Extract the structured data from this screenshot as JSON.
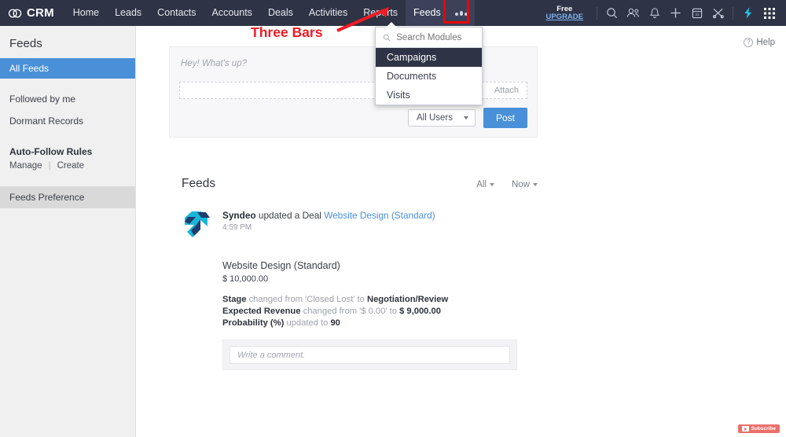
{
  "topbar": {
    "brand": "CRM",
    "nav": [
      {
        "label": "Home",
        "active": false
      },
      {
        "label": "Leads",
        "active": false
      },
      {
        "label": "Contacts",
        "active": false
      },
      {
        "label": "Accounts",
        "active": false
      },
      {
        "label": "Deals",
        "active": false
      },
      {
        "label": "Activities",
        "active": false
      },
      {
        "label": "Reports",
        "active": false
      },
      {
        "label": "Feeds",
        "active": true
      }
    ],
    "more_icon": "three-bars-icon",
    "upgrade": {
      "free": "Free",
      "link": "UPGRADE"
    },
    "icons": [
      "search-icon",
      "users-icon",
      "bell-icon",
      "plus-icon",
      "calendar-icon",
      "tools-icon",
      "lightning-logo-icon",
      "app-grid-icon"
    ],
    "accent": "#4a90d9",
    "background": "#2e3346"
  },
  "modules_dropdown": {
    "search_placeholder": "Search Modules",
    "items": [
      {
        "label": "Campaigns",
        "selected": true
      },
      {
        "label": "Documents",
        "selected": false
      },
      {
        "label": "Visits",
        "selected": false
      }
    ]
  },
  "annotation": {
    "text": "Three Bars",
    "color": "#ee1c25"
  },
  "sidebar": {
    "title": "Feeds",
    "selected": "All Feeds",
    "links": [
      "Followed by me",
      "Dormant Records"
    ],
    "auto_follow": {
      "heading": "Auto-Follow Rules",
      "manage": "Manage",
      "divider": "|",
      "create": "Create"
    },
    "preference": "Feeds Preference"
  },
  "main": {
    "help": "Help",
    "help_icon": "question-circle-icon",
    "composer": {
      "placeholder": "Hey! What's up?",
      "attach": "Attach",
      "audience": "All Users",
      "post": "Post"
    },
    "feeds": {
      "title": "Feeds",
      "filter_scope": "All",
      "filter_time": "Now"
    },
    "post": {
      "author": "Syndeo",
      "action": "updated a Deal",
      "record": "Website Design (Standard)",
      "time": "4:59 PM",
      "deal_name": "Website Design (Standard)",
      "deal_amount": "$ 10,000.00",
      "changes": [
        {
          "field": "Stage",
          "mid": "changed from 'Closed Lost' to",
          "value": "Negotiation/Review"
        },
        {
          "field": "Expected Revenue",
          "mid": "changed from '$ 0.00' to",
          "value": "$ 9,000.00"
        },
        {
          "field": "Probability (%)",
          "mid": "updated to",
          "value": "90"
        }
      ],
      "comment_placeholder": "Write a comment."
    }
  },
  "overlay": {
    "subscribe": "Subscribe"
  }
}
